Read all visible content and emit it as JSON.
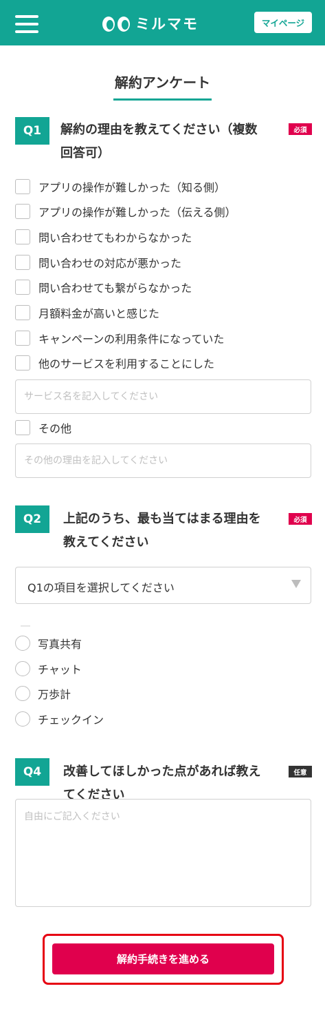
{
  "header": {
    "brand": "ミルマモ",
    "mypage_label": "マイページ",
    "accent_color": "#12a594"
  },
  "page": {
    "title": "解約アンケート"
  },
  "q1": {
    "number": "Q1",
    "title_line1": "解約の理由を教えてください（複数",
    "title_line2": "回答可）",
    "tag": "必須",
    "options": [
      "アプリの操作が難しかった（知る側）",
      "アプリの操作が難しかった（伝える側）",
      "問い合わせてもわからなかった",
      "問い合わせの対応が悪かった",
      "問い合わせても繋がらなかった",
      "月額料金が高いと感じた",
      "キャンペーンの利用条件になっていた",
      "他のサービスを利用することにした"
    ],
    "service_placeholder": "サービス名を記入してください",
    "other_label": "その他",
    "other_placeholder": "その他の理由を記入してください"
  },
  "q2": {
    "number": "Q2",
    "title_line1": "上記のうち、最も当てはまる理由を",
    "title_line2": "教えてください",
    "tag": "必須",
    "select_value": "Q1の項目を選択してください"
  },
  "q3": {
    "options": [
      "写真共有",
      "チャット",
      "万歩計",
      "チェックイン"
    ]
  },
  "q4": {
    "number": "Q4",
    "title_line1": "改善してほしかった点があれば教え",
    "title_line2": "てください",
    "tag": "任意",
    "placeholder": "自由にご記入ください"
  },
  "submit": {
    "label": "解約手続きを進める",
    "color": "#e0004d"
  }
}
